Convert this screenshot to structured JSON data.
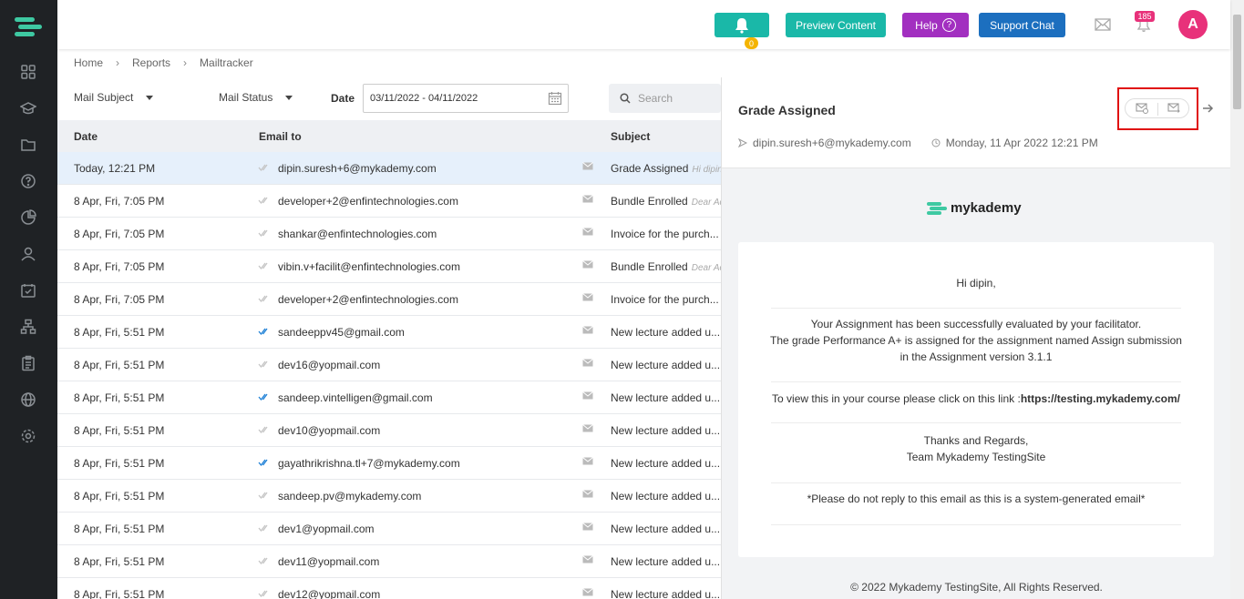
{
  "topbar": {
    "bell_badge": "0",
    "preview_label": "Preview Content",
    "help_label": "Help",
    "help_icon_glyph": "?",
    "support_label": "Support Chat",
    "notification_count": "185",
    "avatar_initial": "A"
  },
  "breadcrumb": [
    "Home",
    "Reports",
    "Mailtracker"
  ],
  "filters": {
    "mail_subject": "Mail Subject",
    "mail_status": "Mail Status",
    "date_label": "Date",
    "date_value": "03/11/2022 - 04/11/2022",
    "search_placeholder": "Search"
  },
  "table": {
    "headers": {
      "date": "Date",
      "email": "Email to",
      "subject": "Subject"
    },
    "rows": [
      {
        "date": "Today, 12:21 PM",
        "email": "dipin.suresh+6@mykademy.com",
        "subject": "Grade Assigned",
        "preview": "Hi dipin",
        "read": false,
        "selected": true
      },
      {
        "date": "8 Apr, Fri, 7:05 PM",
        "email": "developer+2@enfintechnologies.com",
        "subject": "Bundle Enrolled",
        "preview": "Dear Ad",
        "read": false,
        "selected": false
      },
      {
        "date": "8 Apr, Fri, 7:05 PM",
        "email": "shankar@enfintechnologies.com",
        "subject": "Invoice for the purch...",
        "preview": "",
        "read": false,
        "selected": false
      },
      {
        "date": "8 Apr, Fri, 7:05 PM",
        "email": "vibin.v+facilit@enfintechnologies.com",
        "subject": "Bundle Enrolled",
        "preview": "Dear Ac",
        "read": false,
        "selected": false
      },
      {
        "date": "8 Apr, Fri, 7:05 PM",
        "email": "developer+2@enfintechnologies.com",
        "subject": "Invoice for the purch...",
        "preview": "",
        "read": false,
        "selected": false
      },
      {
        "date": "8 Apr, Fri, 5:51 PM",
        "email": "sandeeppv45@gmail.com",
        "subject": "New lecture added u...",
        "preview": "",
        "read": true,
        "selected": false
      },
      {
        "date": "8 Apr, Fri, 5:51 PM",
        "email": "dev16@yopmail.com",
        "subject": "New lecture added u...",
        "preview": "",
        "read": false,
        "selected": false
      },
      {
        "date": "8 Apr, Fri, 5:51 PM",
        "email": "sandeep.vintelligen@gmail.com",
        "subject": "New lecture added u...",
        "preview": "",
        "read": true,
        "selected": false
      },
      {
        "date": "8 Apr, Fri, 5:51 PM",
        "email": "dev10@yopmail.com",
        "subject": "New lecture added u...",
        "preview": "",
        "read": false,
        "selected": false
      },
      {
        "date": "8 Apr, Fri, 5:51 PM",
        "email": "gayathrikrishna.tl+7@mykademy.com",
        "subject": "New lecture added u...",
        "preview": "",
        "read": true,
        "selected": false
      },
      {
        "date": "8 Apr, Fri, 5:51 PM",
        "email": "sandeep.pv@mykademy.com",
        "subject": "New lecture added u...",
        "preview": "",
        "read": false,
        "selected": false
      },
      {
        "date": "8 Apr, Fri, 5:51 PM",
        "email": "dev1@yopmail.com",
        "subject": "New lecture added u...",
        "preview": "",
        "read": false,
        "selected": false
      },
      {
        "date": "8 Apr, Fri, 5:51 PM",
        "email": "dev11@yopmail.com",
        "subject": "New lecture added u...",
        "preview": "",
        "read": false,
        "selected": false
      },
      {
        "date": "8 Apr, Fri, 5:51 PM",
        "email": "dev12@yopmail.com",
        "subject": "New lecture added u...",
        "preview": "",
        "read": false,
        "selected": false
      }
    ]
  },
  "detail": {
    "title": "Grade Assigned",
    "recipient": "dipin.suresh+6@mykademy.com",
    "datetime": "Monday, 11 Apr 2022 12:21 PM",
    "brand": "mykademy",
    "greeting": "Hi dipin,",
    "body_line1": "Your Assignment has been successfully evaluated by your facilitator.",
    "body_line2": "The grade Performance A+ is assigned for the assignment named Assign submission",
    "body_line3": "in the Assignment version 3.1.1",
    "link_prefix": "To view this in your course please click on this link :",
    "link_url": "https://testing.mykademy.com/",
    "thanks": "Thanks and Regards,",
    "team": "Team Mykademy TestingSite",
    "disclaimer": "*Please do not reply to this email as this is a system-generated email*",
    "footer": "© 2022 Mykademy TestingSite, All Rights Reserved."
  },
  "colors": {
    "accent_teal": "#1ab8a8",
    "help_purple": "#a22fc0",
    "support_blue": "#1c6fbf",
    "badge_pink": "#e8317a",
    "read_check_blue": "#1c7fd6",
    "highlight_red": "#e01010"
  }
}
